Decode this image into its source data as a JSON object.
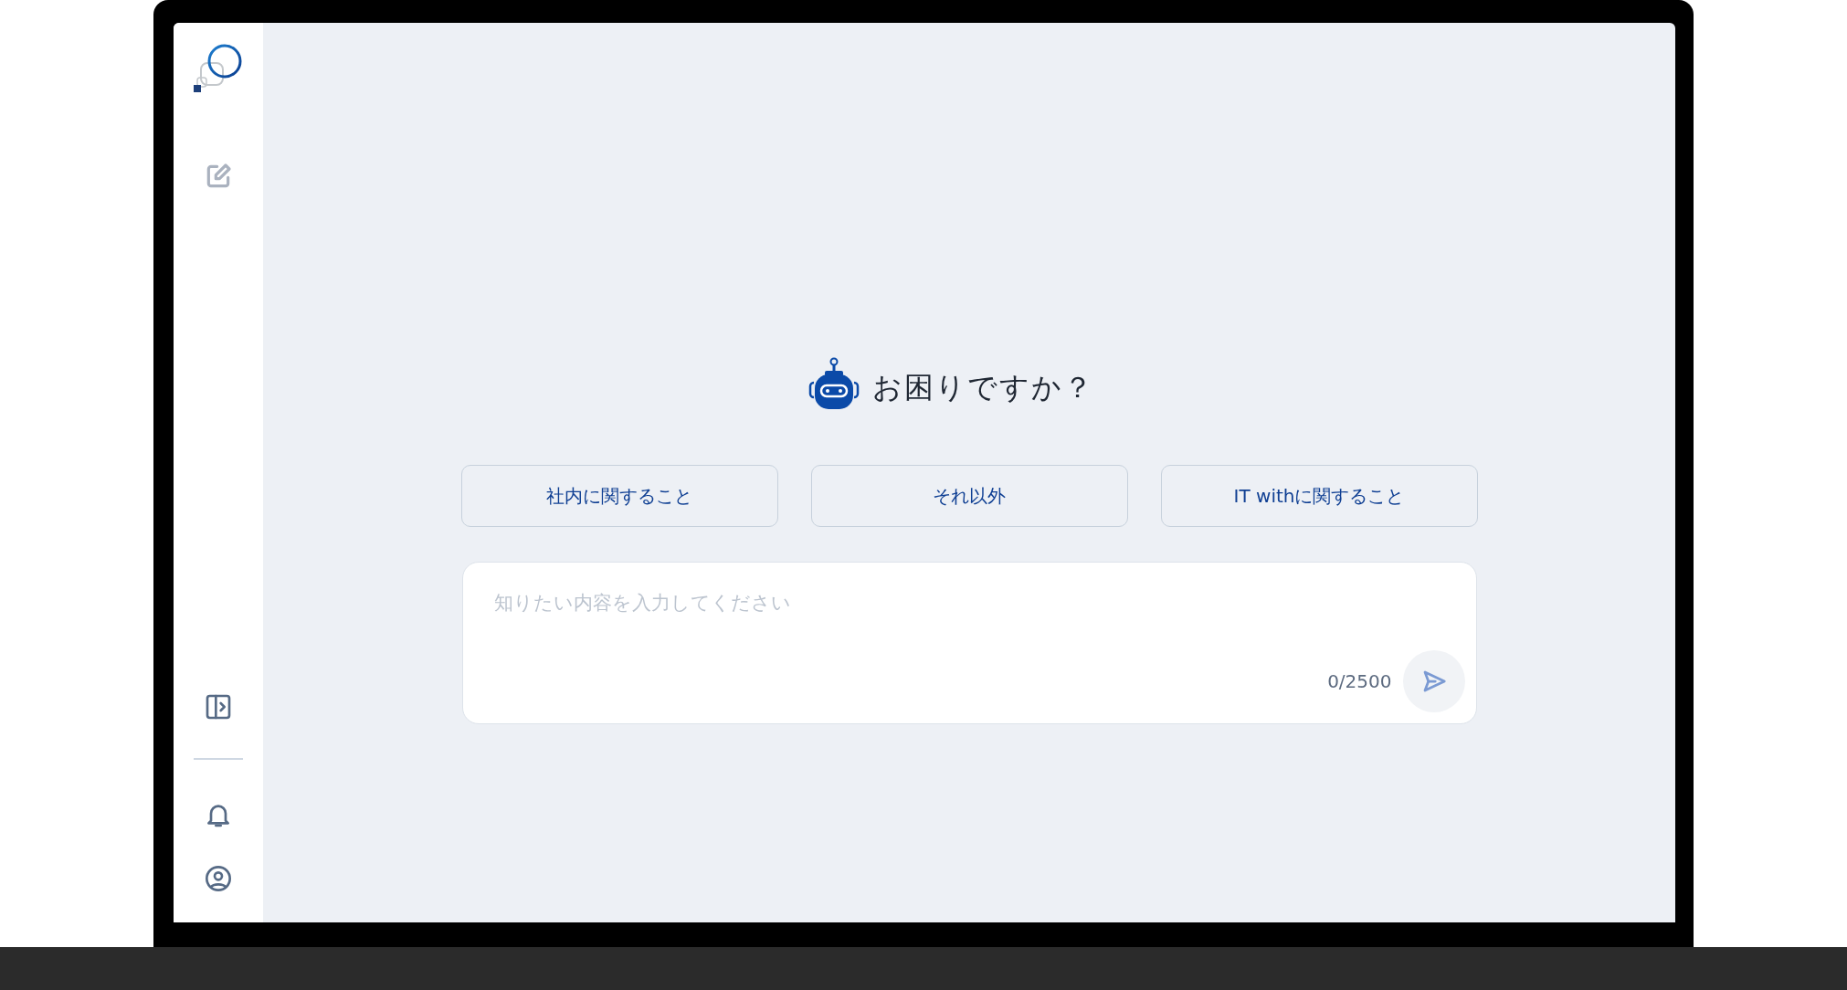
{
  "greeting": {
    "title": "お困りですか？"
  },
  "suggestions": [
    {
      "label": "社内に関すること"
    },
    {
      "label": "それ以外"
    },
    {
      "label": "IT withに関すること"
    }
  ],
  "composer": {
    "placeholder": "知りたい内容を入力してください",
    "counter": "0/2500"
  }
}
